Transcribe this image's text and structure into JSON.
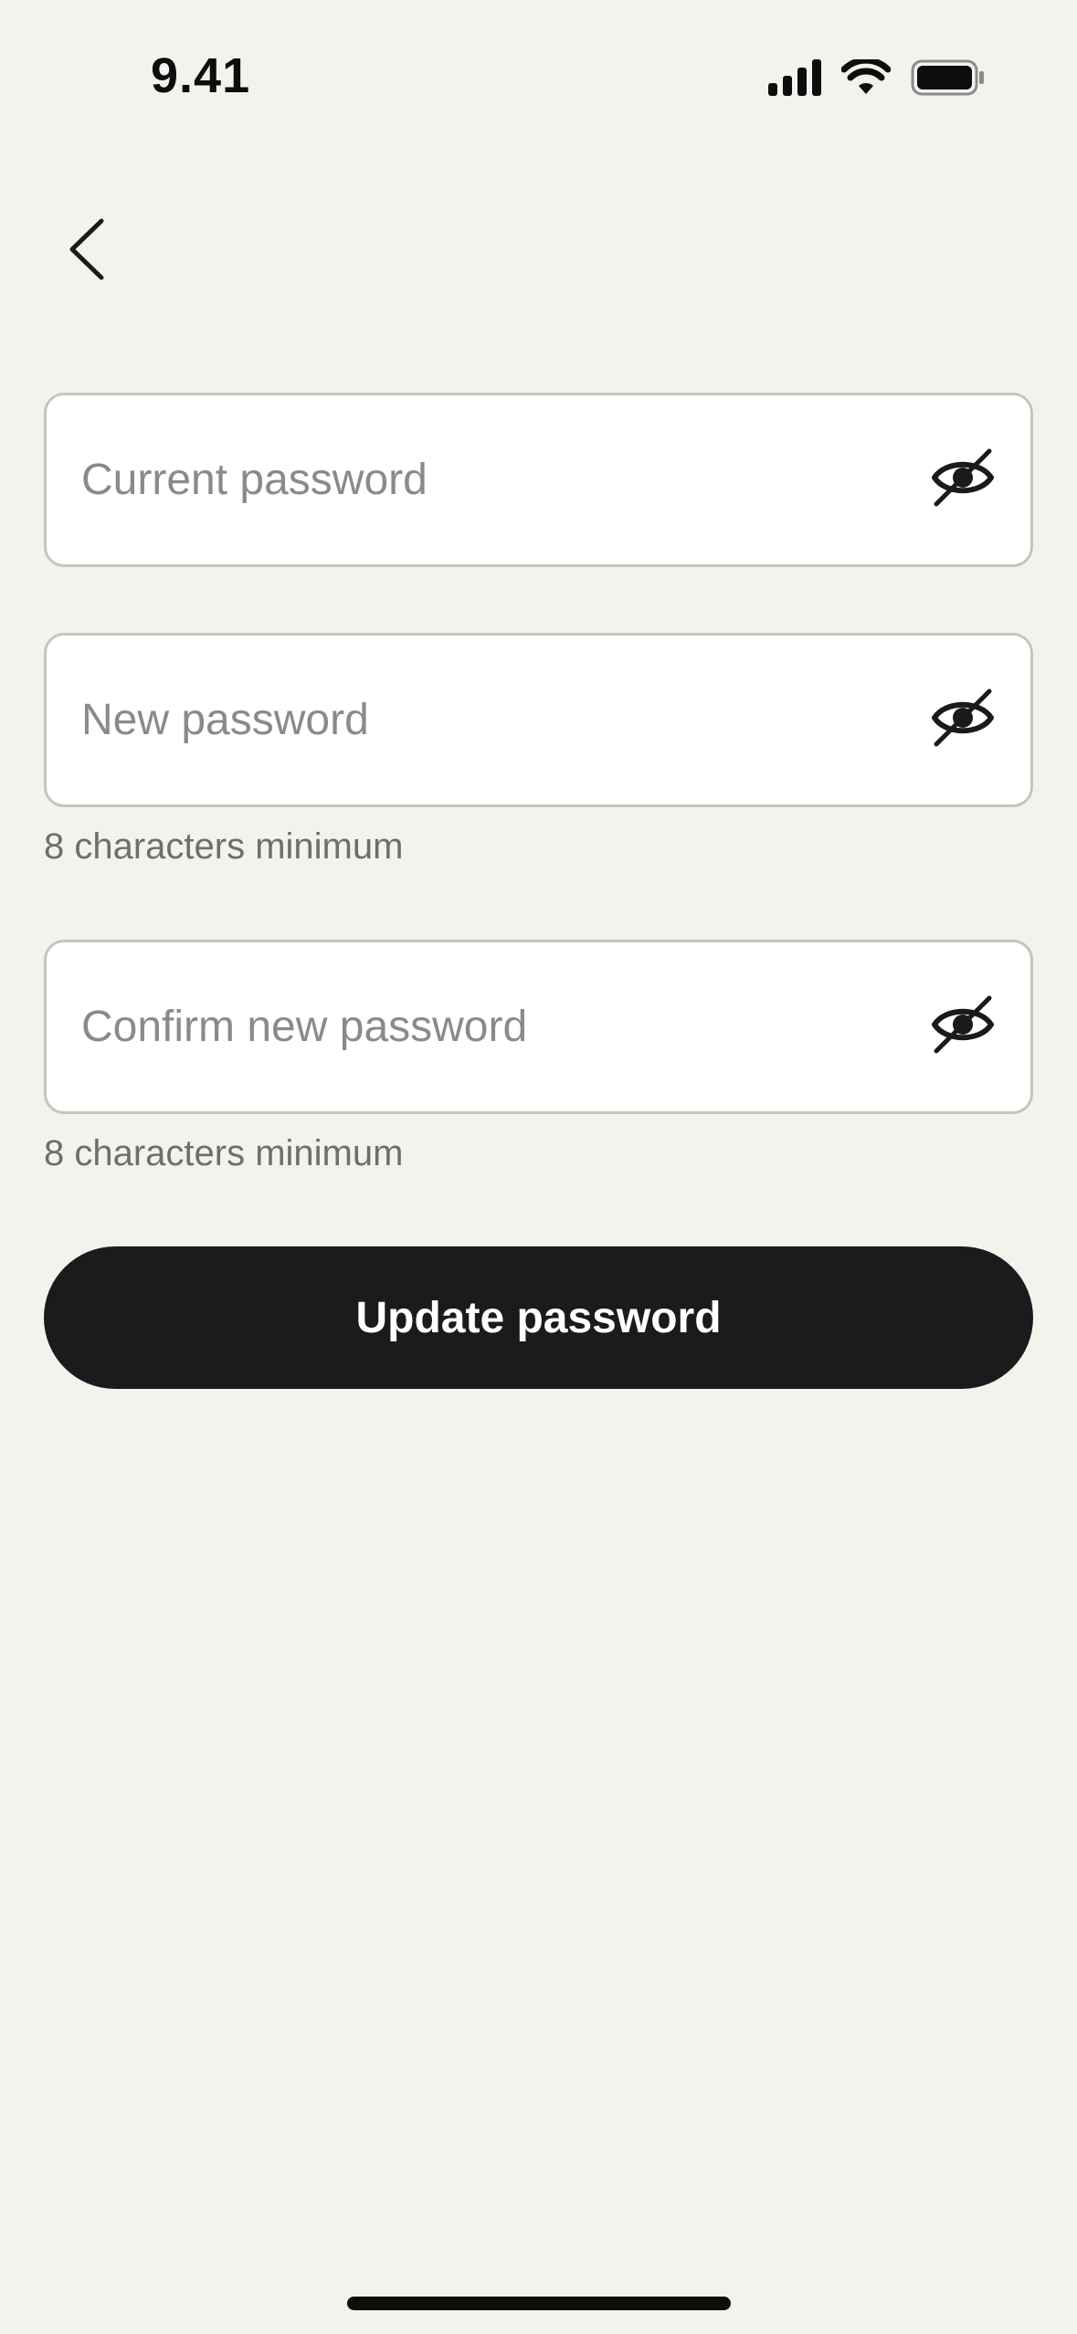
{
  "status_bar": {
    "time": "9.41",
    "icons": [
      "cellular-signal-icon",
      "wifi-icon",
      "battery-icon"
    ]
  },
  "nav": {
    "back_icon": "chevron-left-icon"
  },
  "form": {
    "current_password": {
      "placeholder": "Current password",
      "value": "",
      "toggle_icon": "eye-off-icon"
    },
    "new_password": {
      "placeholder": "New password",
      "value": "",
      "hint": "8 characters minimum",
      "toggle_icon": "eye-off-icon"
    },
    "confirm_password": {
      "placeholder": "Confirm new password",
      "value": "",
      "hint": "8 characters minimum",
      "toggle_icon": "eye-off-icon"
    },
    "submit_label": "Update password"
  },
  "colors": {
    "background": "#f3f3ee",
    "field_background": "#ffffff",
    "field_border": "#c4c4c2",
    "placeholder": "#8a8a88",
    "hint": "#6e6e6c",
    "button_background": "#1a1b1d",
    "button_text": "#ffffff"
  }
}
